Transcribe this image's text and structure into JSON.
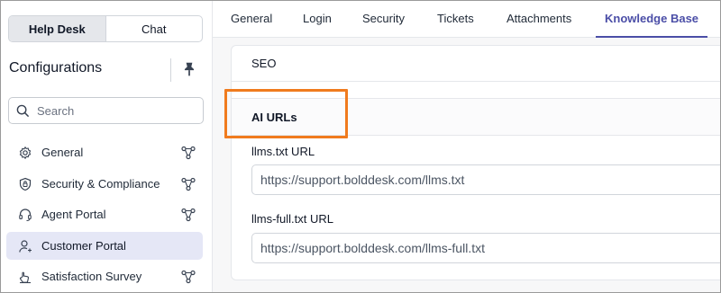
{
  "mode_toggle": {
    "helpdesk": "Help Desk",
    "chat": "Chat"
  },
  "sidebar": {
    "title": "Configurations",
    "search_placeholder": "Search",
    "items": [
      {
        "label": "General",
        "icon": "gear-icon"
      },
      {
        "label": "Security & Compliance",
        "icon": "shield-icon"
      },
      {
        "label": "Agent Portal",
        "icon": "headset-icon"
      },
      {
        "label": "Customer Portal",
        "icon": "user-icon",
        "active": true
      },
      {
        "label": "Satisfaction Survey",
        "icon": "survey-icon"
      }
    ]
  },
  "tabs": [
    {
      "label": "General"
    },
    {
      "label": "Login"
    },
    {
      "label": "Security"
    },
    {
      "label": "Tickets"
    },
    {
      "label": "Attachments"
    },
    {
      "label": "Knowledge Base",
      "active": true
    }
  ],
  "content": {
    "seo_label": "SEO",
    "ai_urls_label": "AI URLs",
    "llms_label": "llms.txt URL",
    "llms_value": "https://support.bolddesk.com/llms.txt",
    "llms_full_label": "llms-full.txt URL",
    "llms_full_value": "https://support.bolddesk.com/llms-full.txt"
  },
  "colors": {
    "accent": "#4b4ea7",
    "highlight": "#f07b1e",
    "active_bg": "#e5e7f6"
  }
}
